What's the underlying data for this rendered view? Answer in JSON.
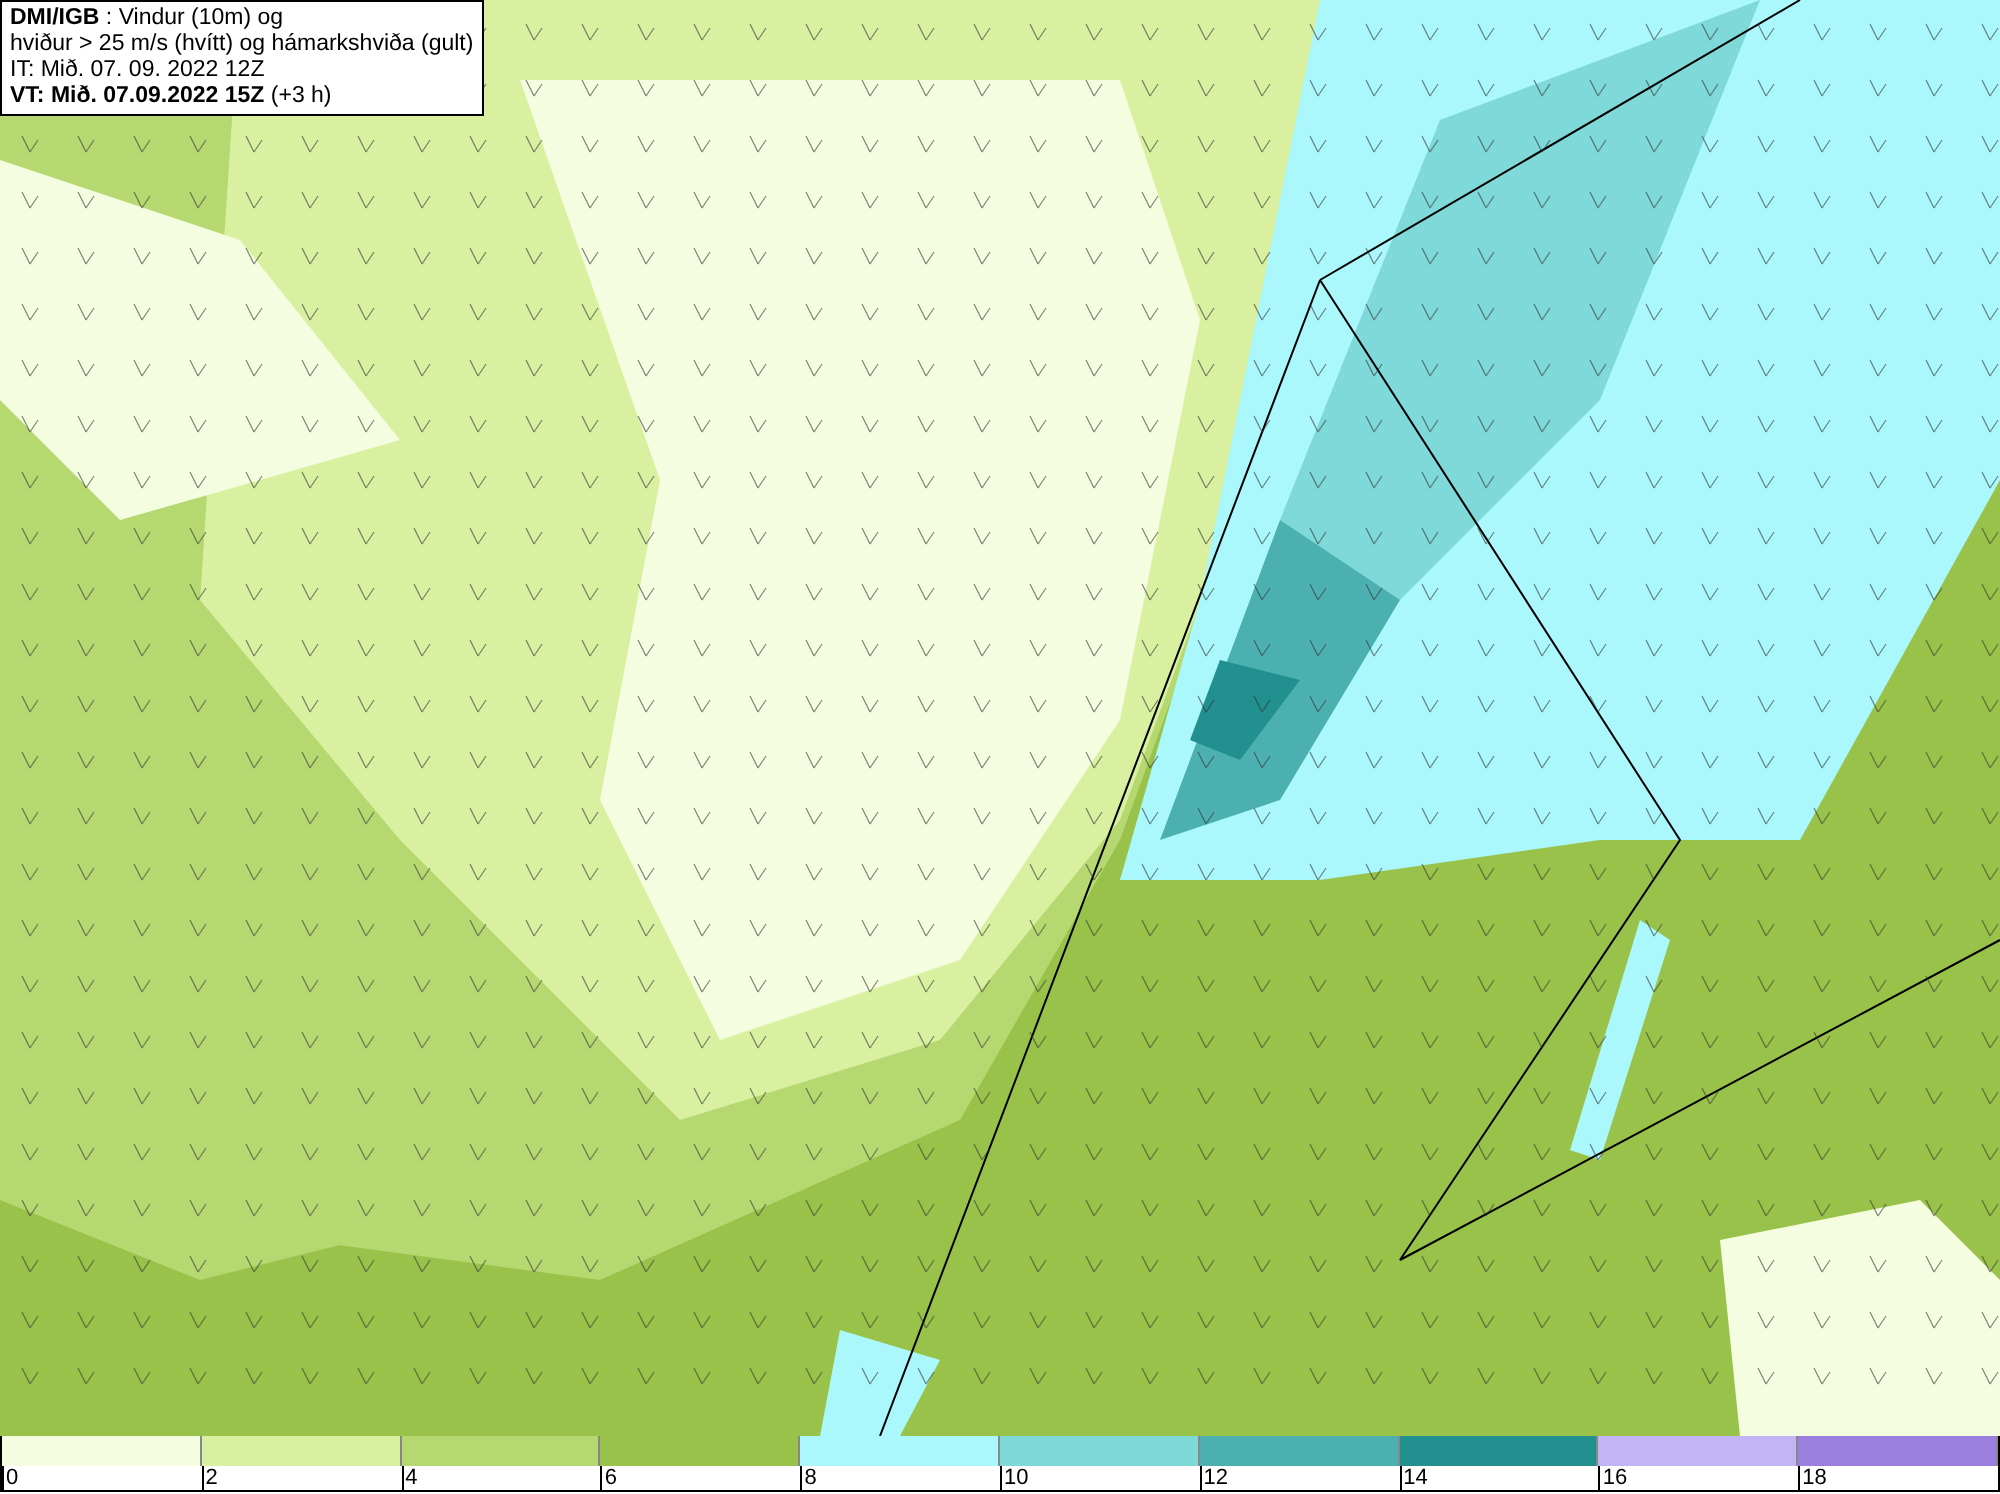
{
  "title_box": {
    "lines": [
      "**DMI/IGB** : Vindur (10m) og",
      "hviður > 25 m/s (hvítt) og hámarkshviða (gult)",
      "IT: Mið. 07. 09. 2022 12Z",
      "**VT: Mið. 07.09.2022 15Z** (+3 h)"
    ]
  },
  "legend": {
    "bins": [
      {
        "label": "0",
        "color": "#f5fde0"
      },
      {
        "label": "2",
        "color": "#d8f0a0"
      },
      {
        "label": "4",
        "color": "#b5d970"
      },
      {
        "label": "6",
        "color": "#99c24a"
      },
      {
        "label": "8",
        "color": "#aaf8fc"
      },
      {
        "label": "10",
        "color": "#7fd9d8"
      },
      {
        "label": "12",
        "color": "#4db0b0"
      },
      {
        "label": "14",
        "color": "#21908f"
      },
      {
        "label": "16",
        "color": "#c3b5f5"
      },
      {
        "label": "18",
        "color": "#9b80e0"
      }
    ]
  }
}
